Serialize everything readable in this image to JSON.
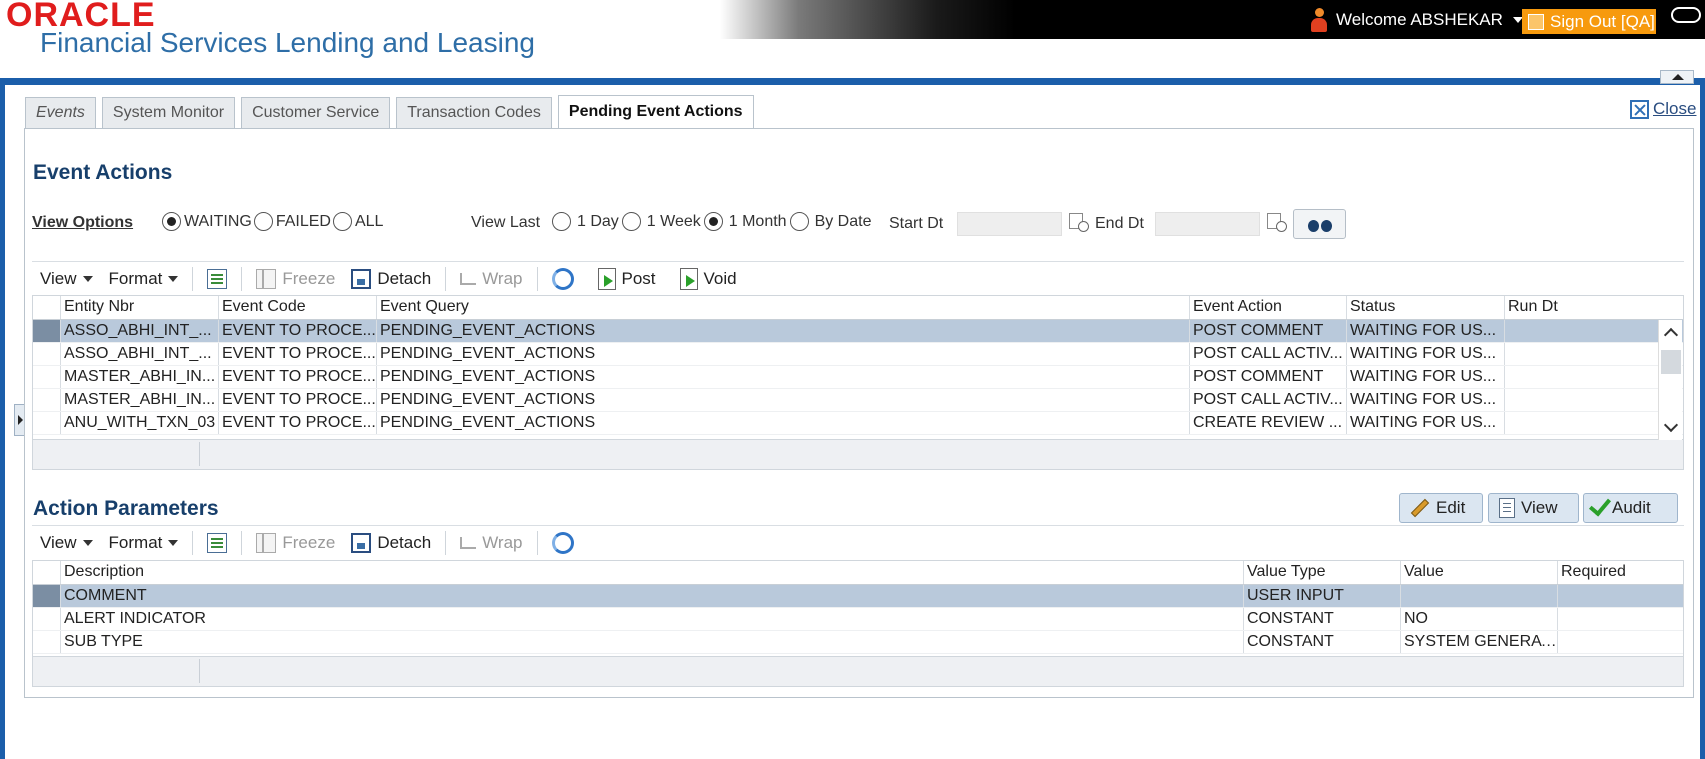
{
  "header": {
    "logo": "ORACLE",
    "product": "Financial Services Lending and Leasing",
    "welcome": "Welcome ABSHEKAR",
    "signout": "Sign Out [QA]"
  },
  "tabs": [
    "Events",
    "System Monitor",
    "Customer Service",
    "Transaction Codes",
    "Pending Event Actions"
  ],
  "close_label": "Close",
  "event_actions": {
    "title": "Event Actions",
    "view_options_label": "View Options",
    "status_options": [
      "WAITING",
      "FAILED",
      "ALL"
    ],
    "status_selected": "WAITING",
    "view_last_label": "View Last",
    "view_last_options": [
      "1 Day",
      "1 Week",
      "1 Month",
      "By Date"
    ],
    "view_last_selected": "1 Month",
    "start_dt_label": "Start Dt",
    "end_dt_label": "End Dt",
    "toolbar": {
      "view": "View",
      "format": "Format",
      "freeze": "Freeze",
      "detach": "Detach",
      "wrap": "Wrap",
      "post": "Post",
      "void": "Void"
    },
    "columns": [
      "Entity Nbr",
      "Event Code",
      "Event Query",
      "Event Action",
      "Status",
      "Run Dt"
    ],
    "rows": [
      [
        "ASSO_ABHI_INT_...",
        "EVENT TO PROCE...",
        "PENDING_EVENT_ACTIONS",
        "POST COMMENT",
        "WAITING FOR US...",
        ""
      ],
      [
        "ASSO_ABHI_INT_...",
        "EVENT TO PROCE...",
        "PENDING_EVENT_ACTIONS",
        "POST CALL ACTIV...",
        "WAITING FOR US...",
        ""
      ],
      [
        "MASTER_ABHI_IN...",
        "EVENT TO PROCE...",
        "PENDING_EVENT_ACTIONS",
        "POST COMMENT",
        "WAITING FOR US...",
        ""
      ],
      [
        "MASTER_ABHI_IN...",
        "EVENT TO PROCE...",
        "PENDING_EVENT_ACTIONS",
        "POST CALL ACTIV...",
        "WAITING FOR US...",
        ""
      ],
      [
        "ANU_WITH_TXN_03",
        "EVENT TO PROCE...",
        "PENDING_EVENT_ACTIONS",
        "CREATE REVIEW ...",
        "WAITING FOR US...",
        ""
      ]
    ]
  },
  "action_parameters": {
    "title": "Action Parameters",
    "buttons": {
      "edit": "Edit",
      "view": "View",
      "audit": "Audit"
    },
    "toolbar": {
      "view": "View",
      "format": "Format",
      "freeze": "Freeze",
      "detach": "Detach",
      "wrap": "Wrap"
    },
    "columns": [
      "Description",
      "Value Type",
      "Value",
      "Required"
    ],
    "rows": [
      [
        "COMMENT",
        "USER INPUT",
        "",
        ""
      ],
      [
        "ALERT INDICATOR",
        "CONSTANT",
        "NO",
        ""
      ],
      [
        "SUB TYPE",
        "CONSTANT",
        "SYSTEM GENERAT...",
        ""
      ]
    ]
  },
  "colors": {
    "brand_blue": "#1b5eaa",
    "oracle_red": "#e01d1d",
    "signout_orange": "#f79a0e",
    "selected_row": "#b9c9db"
  }
}
